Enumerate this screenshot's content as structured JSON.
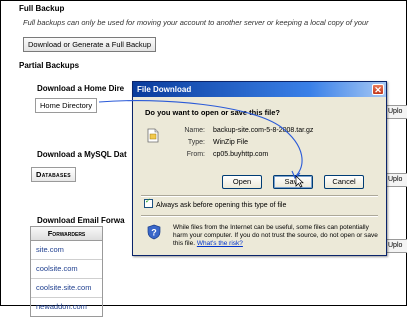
{
  "full_backup": {
    "heading": "Full Backup",
    "note": "Full backups can only be used for moving your account to another server or keeping a local copy of your",
    "button": "Download or Generate a Full Backup"
  },
  "partial_backups": {
    "heading": "Partial Backups"
  },
  "home_section": {
    "heading": "Download a Home Dire",
    "button": "Home Directory",
    "upload": "Uplo"
  },
  "mysql_section": {
    "heading": "Download a MySQL Dat",
    "header_button": "Databases",
    "upload": "Uplo"
  },
  "email_section": {
    "heading": "Download Email Forwa",
    "header": "Forwarders",
    "rows": [
      "site.com",
      "coolsite.com",
      "coolsite.site.com",
      "newaddon.com"
    ],
    "upload": "Uplo"
  },
  "dialog": {
    "title": "File Download",
    "close": "✕",
    "question": "Do you want to open or save this file?",
    "fields": [
      {
        "key": "Name:",
        "value": "backup-site.com-5-8-2008.tar.gz"
      },
      {
        "key": "Type:",
        "value": "WinZip File"
      },
      {
        "key": "From:",
        "value": "cp05.buyhttp.com"
      }
    ],
    "buttons": {
      "open": "Open",
      "save": "Save",
      "cancel": "Cancel"
    },
    "checkbox": "Always ask before opening this type of file",
    "warning": "While files from the Internet can be useful, some files can potentially harm your computer. If you do not trust the source, do not open or save this file.",
    "warning_link": "What's the risk?"
  },
  "colors": {
    "title_bar": "#0a3c9c",
    "dialog_bg": "#ece9d8",
    "link": "#1f3f8f",
    "arrow": "#2a5ad8"
  },
  "icons": [
    "file-icon",
    "shield-icon",
    "close-icon",
    "mouse-cursor-icon"
  ]
}
